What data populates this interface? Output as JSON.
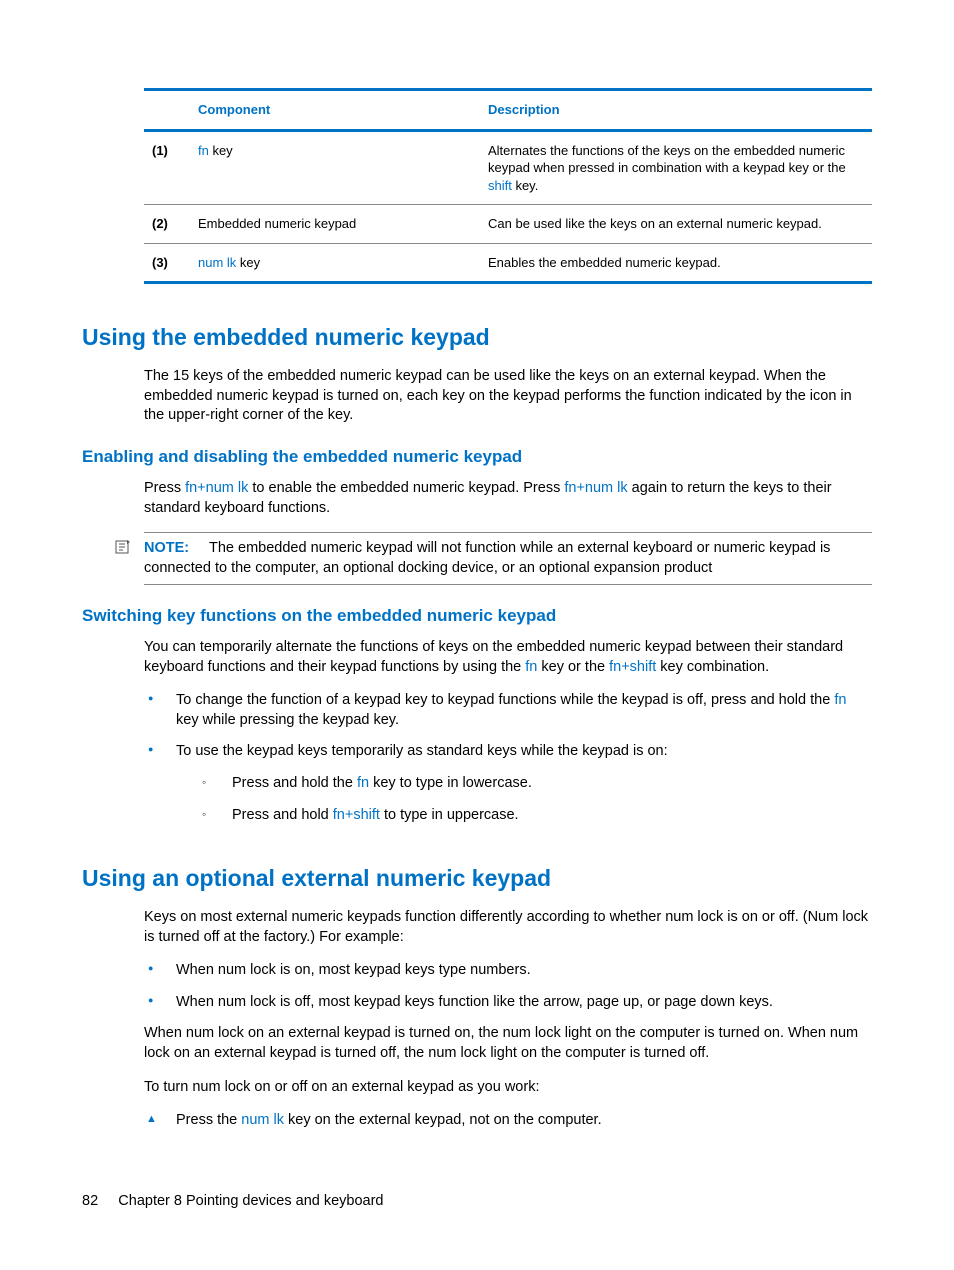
{
  "table": {
    "header": {
      "component": "Component",
      "description": "Description"
    },
    "rows": [
      {
        "num": "(1)",
        "comp_pre": "",
        "comp_link": "fn",
        "comp_post": " key",
        "desc_pre": "Alternates the functions of the keys on the embedded numeric keypad when pressed in combination with a keypad key or the ",
        "desc_link": "shift",
        "desc_post": " key."
      },
      {
        "num": "(2)",
        "comp_pre": "Embedded numeric keypad",
        "comp_link": "",
        "comp_post": "",
        "desc_pre": "Can be used like the keys on an external numeric keypad.",
        "desc_link": "",
        "desc_post": ""
      },
      {
        "num": "(3)",
        "comp_pre": "",
        "comp_link": "num lk",
        "comp_post": " key",
        "desc_pre": "Enables the embedded numeric keypad.",
        "desc_link": "",
        "desc_post": ""
      }
    ]
  },
  "s1": {
    "heading": "Using the embedded numeric keypad",
    "para": "The 15 keys of the embedded numeric keypad can be used like the keys on an external keypad. When the embedded numeric keypad is turned on, each key on the keypad performs the function indicated by the icon in the upper-right corner of the key."
  },
  "s2": {
    "heading": "Enabling and disabling the embedded numeric keypad",
    "p1a": "Press ",
    "p1link1": "fn+num lk",
    "p1b": " to enable the embedded numeric keypad. Press ",
    "p1link2": "fn+num lk",
    "p1c": " again to return the keys to their standard keyboard functions.",
    "note_label": "NOTE:",
    "note_text": "The embedded numeric keypad will not function while an external keyboard or numeric keypad is connected to the computer, an optional docking device, or an optional expansion product"
  },
  "s3": {
    "heading": "Switching key functions on the embedded numeric keypad",
    "p1a": "You can temporarily alternate the functions of keys on the embedded numeric keypad between their standard keyboard functions and their keypad functions by using the ",
    "p1link1": "fn",
    "p1b": " key or the ",
    "p1link2": "fn+shift",
    "p1c": " key combination.",
    "b1a": "To change the function of a keypad key to keypad functions while the keypad is off, press and hold the ",
    "b1link": "fn",
    "b1b": " key while pressing the keypad key.",
    "b2": "To use the keypad keys temporarily as standard keys while the keypad is on:",
    "sb1a": "Press and hold the ",
    "sb1link": "fn",
    "sb1b": " key to type in lowercase.",
    "sb2a": "Press and hold ",
    "sb2link": "fn+shift",
    "sb2b": " to type in uppercase."
  },
  "s4": {
    "heading": "Using an optional external numeric keypad",
    "p1": "Keys on most external numeric keypads function differently according to whether num lock is on or off. (Num lock is turned off at the factory.) For example:",
    "b1": "When num lock is on, most keypad keys type numbers.",
    "b2": "When num lock is off, most keypad keys function like the arrow, page up, or page down keys.",
    "p2": "When num lock on an external keypad is turned on, the num lock light on the computer is turned on. When num lock on an external keypad is turned off, the num lock light on the computer is turned off.",
    "p3": "To turn num lock on or off on an external keypad as you work:",
    "t1a": "Press the ",
    "t1link": "num lk",
    "t1b": " key on the external keypad, not on the computer."
  },
  "footer": {
    "page": "82",
    "chapter": "Chapter 8   Pointing devices and keyboard"
  }
}
